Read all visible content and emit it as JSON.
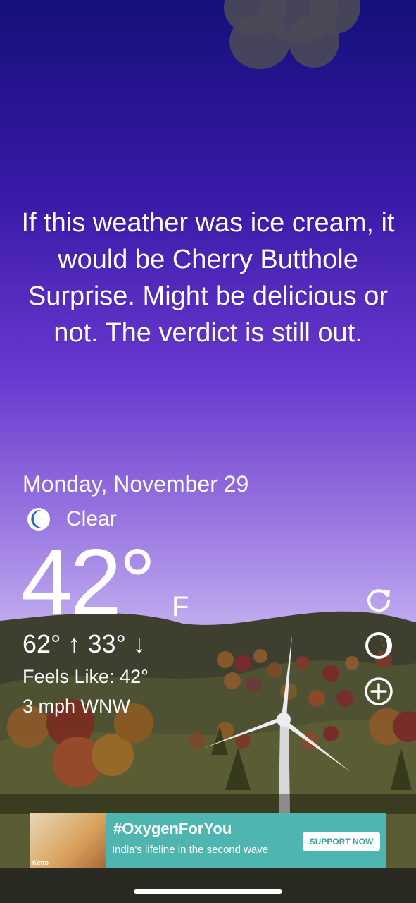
{
  "weather": {
    "quote": "If this weather was ice cream, it would be Cherry Butthole Surprise. Might be delicious or not. The verdict is still out.",
    "date": "Monday, November 29",
    "condition": "Clear",
    "condition_icon": "moon-icon",
    "temperature": "42°",
    "unit": "F",
    "high_low": "62° ↑  33° ↓",
    "feels_like": "Feels Like: 42°",
    "wind": "3 mph WNW"
  },
  "actions": [
    {
      "name": "refresh-icon"
    },
    {
      "name": "theme-toggle-icon"
    },
    {
      "name": "add-icon"
    }
  ],
  "ad": {
    "title": "#OxygenForYou",
    "subtitle": "India's lifeline in the second wave",
    "cta": "SUPPORT NOW",
    "brand": "Ketto"
  },
  "colors": {
    "sky_top": "#14107a",
    "sky_bottom": "#cbb8f2",
    "ad_background": "#4fb5b0",
    "moon": "#2f66d6"
  }
}
